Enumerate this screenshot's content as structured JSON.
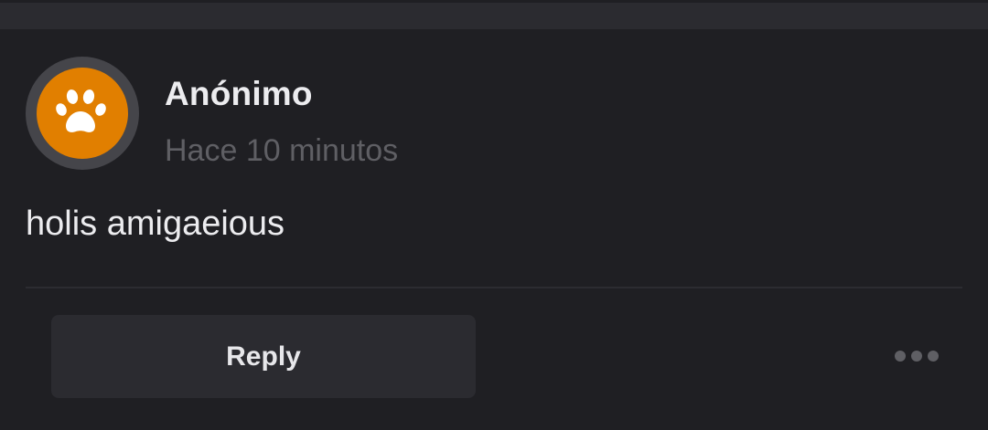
{
  "comment": {
    "author": "Anónimo",
    "timestamp": "Hace 10 minutos",
    "text": "holis amigaeious",
    "avatar_icon": "paw-icon",
    "avatar_color": "#e17f00"
  },
  "actions": {
    "reply_label": "Reply",
    "more_icon": "more-horizontal-icon",
    "more_color": "#5f5f64"
  }
}
